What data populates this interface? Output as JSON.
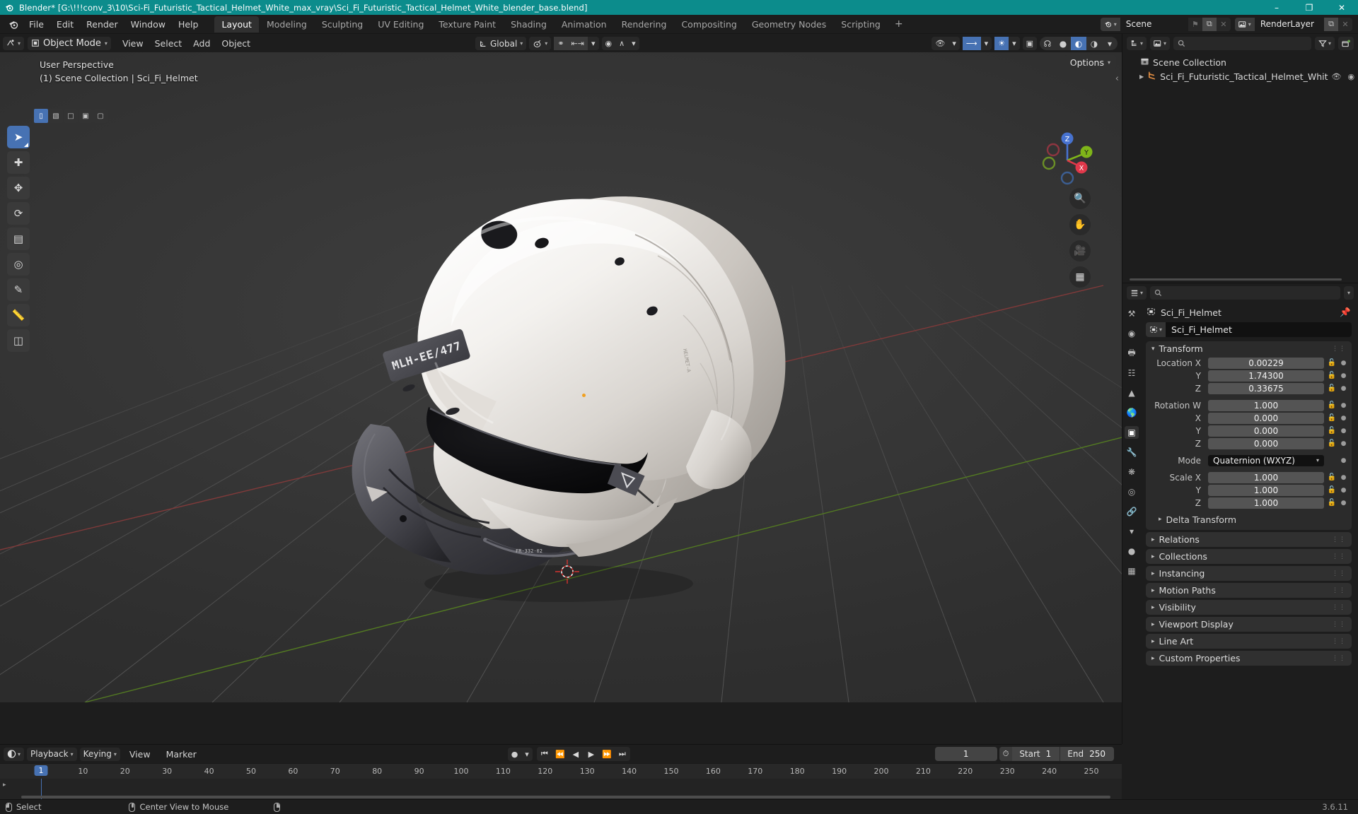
{
  "titlebar": {
    "app_icon": "blender-icon",
    "title": "Blender* [G:\\!!!conv_3\\10\\Sci-Fi_Futuristic_Tactical_Helmet_White_max_vray\\Sci_Fi_Futuristic_Tactical_Helmet_White_blender_base.blend]",
    "minimize": "–",
    "maximize": "❐",
    "close": "✕"
  },
  "topbar": {
    "menus": [
      "File",
      "Edit",
      "Render",
      "Window",
      "Help"
    ],
    "workspaces": [
      {
        "label": "Layout",
        "active": true
      },
      {
        "label": "Modeling",
        "active": false
      },
      {
        "label": "Sculpting",
        "active": false
      },
      {
        "label": "UV Editing",
        "active": false
      },
      {
        "label": "Texture Paint",
        "active": false
      },
      {
        "label": "Shading",
        "active": false
      },
      {
        "label": "Animation",
        "active": false
      },
      {
        "label": "Rendering",
        "active": false
      },
      {
        "label": "Compositing",
        "active": false
      },
      {
        "label": "Geometry Nodes",
        "active": false
      },
      {
        "label": "Scripting",
        "active": false
      }
    ],
    "add_workspace": "+",
    "scene": {
      "label": "Scene",
      "new_btn": "⧉",
      "unlink_btn": "✕",
      "pin": "⚑"
    },
    "viewlayer": {
      "label": "RenderLayer",
      "new_btn": "⧉",
      "unlink_btn": "✕"
    }
  },
  "viewport": {
    "editor_type": "editor-type-3dview",
    "mode": "Object Mode",
    "menus": [
      "View",
      "Select",
      "Add",
      "Object"
    ],
    "transform_orientation": "Global",
    "snap_enabled": true,
    "proportional_edit": false,
    "overlay_on": true,
    "xray_on": true,
    "gizmo_on": true,
    "shading_mode": "material-preview",
    "options_label": "Options",
    "info_line1": "User Perspective",
    "info_line2": "(1) Scene Collection | Sci_Fi_Helmet",
    "select_modes": [
      "tweak",
      "box",
      "circle",
      "lasso",
      "select-box-alt"
    ],
    "tools": [
      {
        "name": "tweak-select-tool",
        "glyph": "➤",
        "active": true
      },
      {
        "name": "cursor-tool",
        "glyph": "⊕",
        "active": false
      },
      {
        "name": "move-tool",
        "glyph": "✥",
        "active": false
      },
      {
        "name": "rotate-tool",
        "glyph": "↻",
        "active": false
      },
      {
        "name": "scale-tool",
        "glyph": "⛶",
        "active": false
      },
      {
        "name": "transform-tool",
        "glyph": "⬚",
        "active": false
      },
      {
        "name": "annotate-tool",
        "glyph": "✎",
        "active": false
      },
      {
        "name": "measure-tool",
        "glyph": "↗",
        "active": false
      },
      {
        "name": "add-cube-tool",
        "glyph": "▣",
        "active": false
      }
    ],
    "nav_buttons": [
      "zoom-icon",
      "pan-hand-icon",
      "camera-icon",
      "ortho-grid-icon"
    ],
    "gizmo_axes": [
      {
        "label": "Z",
        "color": "#4772cf"
      },
      {
        "label": "Y",
        "color": "#7fb519"
      },
      {
        "label": "X",
        "color": "#e0384a"
      }
    ]
  },
  "outliner": {
    "display_mode": "view-layer",
    "filter_icon": "filter-icon",
    "new_collection_icon": "new-collection-icon",
    "search_placeholder": "",
    "rows": [
      {
        "label": "Scene Collection",
        "icon": "collection-icon",
        "depth": 0,
        "expandable": false
      },
      {
        "label": "Sci_Fi_Futuristic_Tactical_Helmet_Whit",
        "icon": "mesh-object-icon",
        "depth": 1,
        "expandable": true,
        "eye": "👁",
        "camera": "◉"
      }
    ]
  },
  "properties": {
    "breadcrumb_object": "Sci_Fi_Helmet",
    "object_name": "Sci_Fi_Helmet",
    "search_placeholder": "",
    "tabs": [
      {
        "name": "tool-tab",
        "glyph": "⚒",
        "active": false
      },
      {
        "name": "render-tab",
        "glyph": "◷",
        "active": false
      },
      {
        "name": "output-tab",
        "glyph": "⎙",
        "active": false
      },
      {
        "name": "view-layer-tab",
        "glyph": "❐",
        "active": false
      },
      {
        "name": "scene-tab",
        "glyph": "△",
        "active": false
      },
      {
        "name": "world-tab",
        "glyph": "♁",
        "active": false
      },
      {
        "name": "object-tab",
        "glyph": "▣",
        "active": true
      },
      {
        "name": "modifiers-tab",
        "glyph": "🔧",
        "active": false
      },
      {
        "name": "particles-tab",
        "glyph": "∴",
        "active": false
      },
      {
        "name": "physics-tab",
        "glyph": "◌",
        "active": false
      },
      {
        "name": "constraints-tab",
        "glyph": "⛓",
        "active": false
      },
      {
        "name": "data-tab",
        "glyph": "▽",
        "active": false
      },
      {
        "name": "material-tab",
        "glyph": "●",
        "active": false
      },
      {
        "name": "texture-tab",
        "glyph": "▦",
        "active": false
      }
    ],
    "transform": {
      "title": "Transform",
      "fields": [
        {
          "label": "Location X",
          "value": "0.00229"
        },
        {
          "label": "Y",
          "value": "1.74300"
        },
        {
          "label": "Z",
          "value": "0.33675"
        },
        {
          "label": "Rotation W",
          "value": "1.000"
        },
        {
          "label": "X",
          "value": "0.000"
        },
        {
          "label": "Y",
          "value": "0.000"
        },
        {
          "label": "Z",
          "value": "0.000"
        }
      ],
      "mode_label": "Mode",
      "mode_value": "Quaternion (WXYZ)",
      "scale_fields": [
        {
          "label": "Scale X",
          "value": "1.000"
        },
        {
          "label": "Y",
          "value": "1.000"
        },
        {
          "label": "Z",
          "value": "1.000"
        }
      ],
      "delta_transform": "Delta Transform"
    },
    "panels": [
      "Relations",
      "Collections",
      "Instancing",
      "Motion Paths",
      "Visibility",
      "Viewport Display",
      "Line Art",
      "Custom Properties"
    ]
  },
  "timeline": {
    "editor_type": "editor-type-timeline",
    "menus": [
      "Playback",
      "Keying",
      "View",
      "Marker"
    ],
    "auto_key_icon": "record-icon",
    "transport": [
      "jump-start",
      "prev-keyframe",
      "play-reverse",
      "play",
      "next-keyframe",
      "jump-end"
    ],
    "current_frame": "1",
    "start_label": "Start",
    "start_value": "1",
    "end_label": "End",
    "end_value": "250",
    "ticks": [
      10,
      20,
      30,
      40,
      50,
      60,
      70,
      80,
      90,
      100,
      110,
      120,
      130,
      140,
      150,
      160,
      170,
      180,
      190,
      200,
      210,
      220,
      230,
      240,
      250
    ],
    "playhead_label": "1"
  },
  "statusbar": {
    "items": [
      {
        "icon": "mouse-left-icon",
        "label": "Select"
      },
      {
        "icon": "mouse-middle-icon",
        "label": "Center View to Mouse"
      },
      {
        "icon": "mouse-right-icon",
        "label": ""
      }
    ],
    "version": "3.6.11"
  },
  "colors": {
    "accent_blue": "#4772b3",
    "title_teal": "#0c8c8c",
    "axis_x": "#e0384a",
    "axis_y": "#7fb519",
    "axis_z": "#4772cf",
    "origin_orange": "#f0a020"
  }
}
